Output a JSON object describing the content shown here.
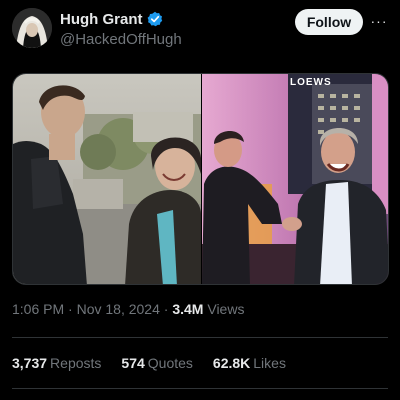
{
  "author": {
    "display_name": "Hugh Grant",
    "handle": "@HackedOffHugh",
    "verified_icon": "verified-badge-icon",
    "avatar_icon": "nun-avatar-image"
  },
  "follow_button": {
    "label": "Follow"
  },
  "more_button": {
    "label": "···",
    "icon": "more-options-icon"
  },
  "media": {
    "left_image": "film-still-two-people-street",
    "right_image": "evening-event-two-men-laughing",
    "sign_text": "LOEWS"
  },
  "post_meta": {
    "time": "1:06 PM",
    "separator": "·",
    "date": "Nov 18, 2024",
    "views_count": "3.4M",
    "views_label": "Views"
  },
  "stats": [
    {
      "count": "3,737",
      "label": "Reposts"
    },
    {
      "count": "574",
      "label": "Quotes"
    },
    {
      "count": "62.8K",
      "label": "Likes"
    }
  ],
  "colors": {
    "background": "#000000",
    "text_primary": "#e7e9ea",
    "text_secondary": "#71767b",
    "verified_blue": "#1d9bf0",
    "divider": "#2f3336",
    "follow_bg": "#eff3f4"
  }
}
